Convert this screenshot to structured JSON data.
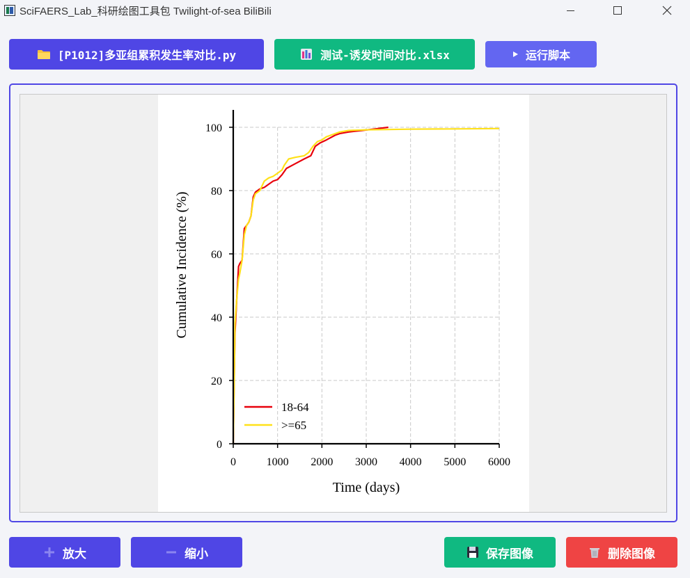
{
  "window": {
    "title": "SciFAERS_Lab_科研绘图工具包 Twilight-of-sea BiliBili",
    "minimize_icon": "minimize-icon",
    "maximize_icon": "maximize-icon",
    "close_icon": "close-icon"
  },
  "toolbar": {
    "file_label": "[P1012]多亚组累积发生率对比.py",
    "file_icon": "folder-icon",
    "excel_label": "测试-诱发时间对比.xlsx",
    "excel_icon": "excel-file-icon",
    "run_label": "运行脚本",
    "run_icon": "play-icon"
  },
  "bottom_bar": {
    "zoom_in_label": "放大",
    "zoom_in_icon": "plus-icon",
    "zoom_out_label": "缩小",
    "zoom_out_icon": "minus-icon",
    "save_label": "保存图像",
    "save_icon": "floppy-disk-icon",
    "delete_label": "删除图像",
    "delete_icon": "trash-icon"
  },
  "colors": {
    "primary": "#4f46e5",
    "success": "#10b981",
    "danger": "#ef4444",
    "run": "#6366f1"
  },
  "chart_data": {
    "type": "line",
    "xlabel": "Time (days)",
    "ylabel": "Cumulative Incidence (%)",
    "xlim": [
      0,
      6000
    ],
    "ylim": [
      0,
      100
    ],
    "xticks": [
      0,
      1000,
      2000,
      3000,
      4000,
      5000,
      6000
    ],
    "yticks": [
      0,
      20,
      40,
      60,
      80,
      100
    ],
    "grid": true,
    "legend_position": "bottom-left",
    "series": [
      {
        "name": "18-64",
        "color": "#e8000b",
        "x": [
          0,
          20,
          40,
          80,
          120,
          150,
          200,
          250,
          300,
          350,
          400,
          450,
          500,
          600,
          700,
          800,
          900,
          1000,
          1100,
          1200,
          1400,
          1600,
          1750,
          1850,
          1950,
          2100,
          2300,
          2400,
          2600,
          2900,
          3200,
          3500
        ],
        "y": [
          0,
          20,
          35,
          46,
          56,
          57,
          58,
          68,
          69,
          70,
          72,
          78,
          79.5,
          80.5,
          81,
          82,
          83,
          83.5,
          85,
          87,
          88.5,
          90,
          91,
          94,
          95,
          96,
          97.5,
          98,
          98.5,
          99,
          99.5,
          100
        ]
      },
      {
        "name": ">=65",
        "color": "#ffe119",
        "x": [
          0,
          20,
          40,
          80,
          120,
          150,
          200,
          250,
          300,
          350,
          400,
          450,
          500,
          600,
          700,
          800,
          900,
          1000,
          1100,
          1150,
          1250,
          1400,
          1600,
          1700,
          1800,
          1900,
          2000,
          2100,
          2200,
          2400,
          2600,
          3000,
          3500,
          4000,
          5000,
          6000
        ],
        "y": [
          0,
          18,
          38,
          46,
          52,
          54,
          58,
          66,
          69,
          70,
          72,
          77,
          79,
          80,
          83,
          84,
          84.5,
          85.5,
          86.5,
          88,
          90,
          90.5,
          91,
          92,
          94,
          95.5,
          96,
          97,
          97.5,
          98.5,
          99,
          99.2,
          99.3,
          99.4,
          99.5,
          99.6
        ]
      }
    ]
  }
}
